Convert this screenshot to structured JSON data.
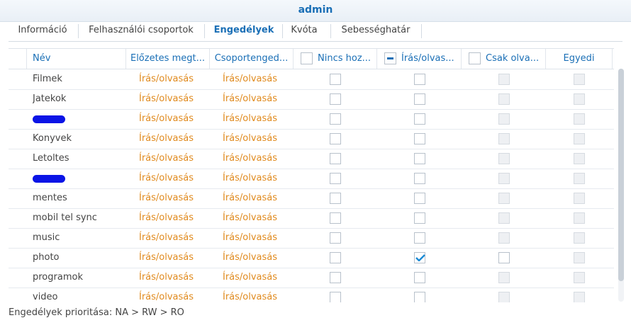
{
  "window": {
    "title": "admin"
  },
  "tabs": [
    "Információ",
    "Felhasználói csoportok",
    "Engedélyek",
    "Kvóta",
    "Sebességhatár"
  ],
  "active_tab": "Engedélyek",
  "columns": {
    "name": "Név",
    "preview": "Előzetes megt...",
    "group": "Csoportenged...",
    "no_access": "Nincs hoz...",
    "read_write": "Írás/olvas...",
    "read_only": "Csak olva...",
    "custom": "Egyedi"
  },
  "header_checks": {
    "no_access": "unchecked",
    "read_write": "partial",
    "read_only": "unchecked"
  },
  "rows": [
    {
      "name": "Filmek",
      "preview": "Írás/olvasás",
      "group": "Írás/olvasás",
      "redacted": false,
      "na": false,
      "rw": false,
      "ro": false,
      "ro_enabled": false
    },
    {
      "name": "Jatekok",
      "preview": "Írás/olvasás",
      "group": "Írás/olvasás",
      "redacted": false,
      "na": false,
      "rw": false,
      "ro": false,
      "ro_enabled": false
    },
    {
      "name": "",
      "preview": "Írás/olvasás",
      "group": "Írás/olvasás",
      "redacted": true,
      "na": false,
      "rw": false,
      "ro": false,
      "ro_enabled": false
    },
    {
      "name": "Konyvek",
      "preview": "Írás/olvasás",
      "group": "Írás/olvasás",
      "redacted": false,
      "na": false,
      "rw": false,
      "ro": false,
      "ro_enabled": false
    },
    {
      "name": "Letoltes",
      "preview": "Írás/olvasás",
      "group": "Írás/olvasás",
      "redacted": false,
      "na": false,
      "rw": false,
      "ro": false,
      "ro_enabled": false
    },
    {
      "name": "",
      "preview": "Írás/olvasás",
      "group": "Írás/olvasás",
      "redacted": true,
      "na": false,
      "rw": false,
      "ro": false,
      "ro_enabled": false
    },
    {
      "name": "mentes",
      "preview": "Írás/olvasás",
      "group": "Írás/olvasás",
      "redacted": false,
      "na": false,
      "rw": false,
      "ro": false,
      "ro_enabled": false
    },
    {
      "name": "mobil tel sync",
      "preview": "Írás/olvasás",
      "group": "Írás/olvasás",
      "redacted": false,
      "na": false,
      "rw": false,
      "ro": false,
      "ro_enabled": false
    },
    {
      "name": "music",
      "preview": "Írás/olvasás",
      "group": "Írás/olvasás",
      "redacted": false,
      "na": false,
      "rw": false,
      "ro": false,
      "ro_enabled": false
    },
    {
      "name": "photo",
      "preview": "Írás/olvasás",
      "group": "Írás/olvasás",
      "redacted": false,
      "na": false,
      "rw": true,
      "ro": false,
      "ro_enabled": true
    },
    {
      "name": "programok",
      "preview": "Írás/olvasás",
      "group": "Írás/olvasás",
      "redacted": false,
      "na": false,
      "rw": false,
      "ro": false,
      "ro_enabled": false
    },
    {
      "name": "video",
      "preview": "Írás/olvasás",
      "group": "Írás/olvasás",
      "redacted": false,
      "na": false,
      "rw": false,
      "ro": false,
      "ro_enabled": false
    }
  ],
  "footer": "Engedélyek prioritása: NA > RW > RO",
  "colors": {
    "accent": "#1a6fb6",
    "value_orange": "#e08a1e",
    "check": "#1a8ad4"
  }
}
